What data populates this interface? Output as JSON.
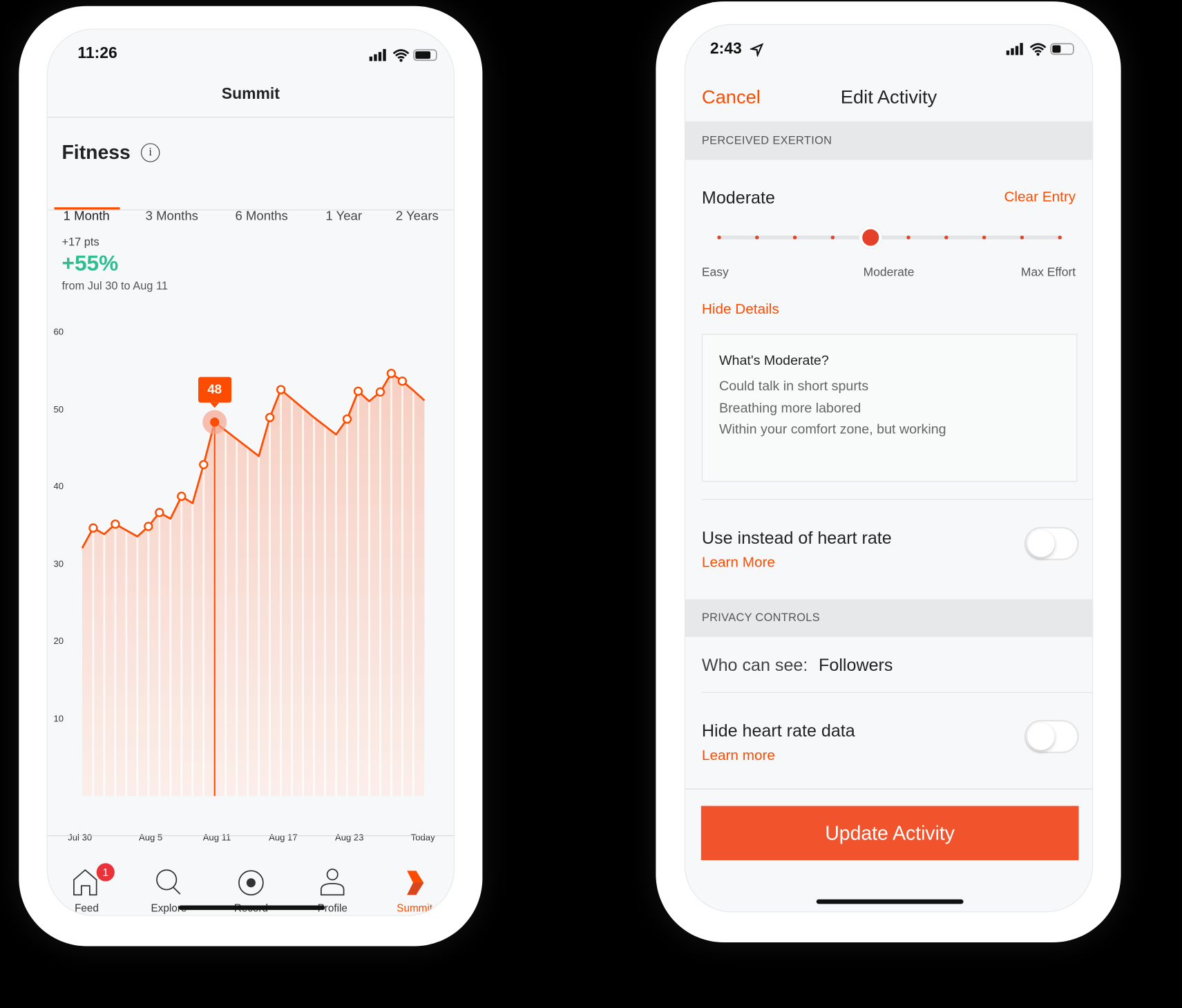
{
  "left_phone": {
    "status_time": "11:26",
    "title": "Summit",
    "section_title": "Fitness",
    "tabs": [
      {
        "label": "1 Month",
        "active": true
      },
      {
        "label": "3 Months"
      },
      {
        "label": "6 Months"
      },
      {
        "label": "1 Year"
      },
      {
        "label": "2 Years"
      }
    ],
    "pts": "+17 pts",
    "percent": "+55%",
    "range": "from Jul 30 to Aug 11",
    "tooltip": "48",
    "nav": [
      {
        "label": "Feed",
        "icon": "home-icon",
        "badge": "1"
      },
      {
        "label": "Explore",
        "icon": "search-icon"
      },
      {
        "label": "Record",
        "icon": "record-icon"
      },
      {
        "label": "Profile",
        "icon": "profile-icon"
      },
      {
        "label": "Summit",
        "icon": "summit-icon",
        "active": true
      }
    ]
  },
  "chart_data": {
    "type": "area",
    "x": [
      "Jul 30",
      "Jul 31",
      "Aug 1",
      "Aug 2",
      "Aug 3",
      "Aug 4",
      "Aug 5",
      "Aug 6",
      "Aug 7",
      "Aug 8",
      "Aug 9",
      "Aug 10",
      "Aug 11",
      "Aug 12",
      "Aug 13",
      "Aug 14",
      "Aug 15",
      "Aug 16",
      "Aug 17",
      "Aug 18",
      "Aug 19",
      "Aug 20",
      "Aug 21",
      "Aug 22",
      "Aug 23",
      "Aug 24",
      "Aug 25",
      "Aug 26",
      "Aug 27",
      "Aug 28",
      "Aug 29",
      "Today"
    ],
    "values": [
      32.1,
      34.7,
      33.9,
      35.2,
      34.4,
      33.6,
      34.9,
      36.7,
      35.9,
      38.8,
      37.9,
      42.9,
      48.4,
      47.3,
      46.2,
      45.1,
      44.0,
      49.0,
      52.6,
      51.4,
      50.2,
      49.0,
      47.9,
      46.8,
      48.8,
      52.4,
      51.1,
      52.3,
      54.7,
      53.7,
      52.5,
      51.2
    ],
    "markers": [
      1,
      3,
      6,
      7,
      9,
      11,
      17,
      18,
      24,
      25,
      27,
      28,
      29
    ],
    "highlight_index": 12,
    "yticks": [
      "60",
      "50",
      "40",
      "30",
      "20",
      "10"
    ],
    "ylim": [
      0,
      60
    ],
    "xtick_labels": [
      "Jul 30",
      "Aug 5",
      "Aug 11",
      "Aug 17",
      "Aug 23",
      "Today"
    ],
    "grid": false,
    "color": "#fc4c02"
  },
  "right_phone": {
    "status_time": "2:43",
    "cancel": "Cancel",
    "title": "Edit Activity",
    "section_exertion": "PERCEIVED EXERTION",
    "exertion_value": "Moderate",
    "clear_entry": "Clear Entry",
    "slider": {
      "steps": 10,
      "selected_step": 5
    },
    "slider_labels": [
      "Easy",
      "Moderate",
      "Max Effort"
    ],
    "hide_details": "Hide Details",
    "details": {
      "title": "What's Moderate?",
      "lines": [
        "Could talk in short spurts",
        "Breathing more labored",
        "Within your comfort zone, but working"
      ]
    },
    "use_instead": "Use instead of heart rate",
    "use_instead_on": false,
    "learn_more_1": "Learn More",
    "section_privacy": "PRIVACY CONTROLS",
    "who_can_see_label": "Who can see:",
    "who_can_see_value": "Followers",
    "hide_hr": "Hide heart rate data",
    "hide_hr_on": false,
    "learn_more_2": "Learn more",
    "update_button": "Update Activity"
  },
  "colors": {
    "accent": "#fc4c02",
    "positive": "#2fbf8f"
  }
}
